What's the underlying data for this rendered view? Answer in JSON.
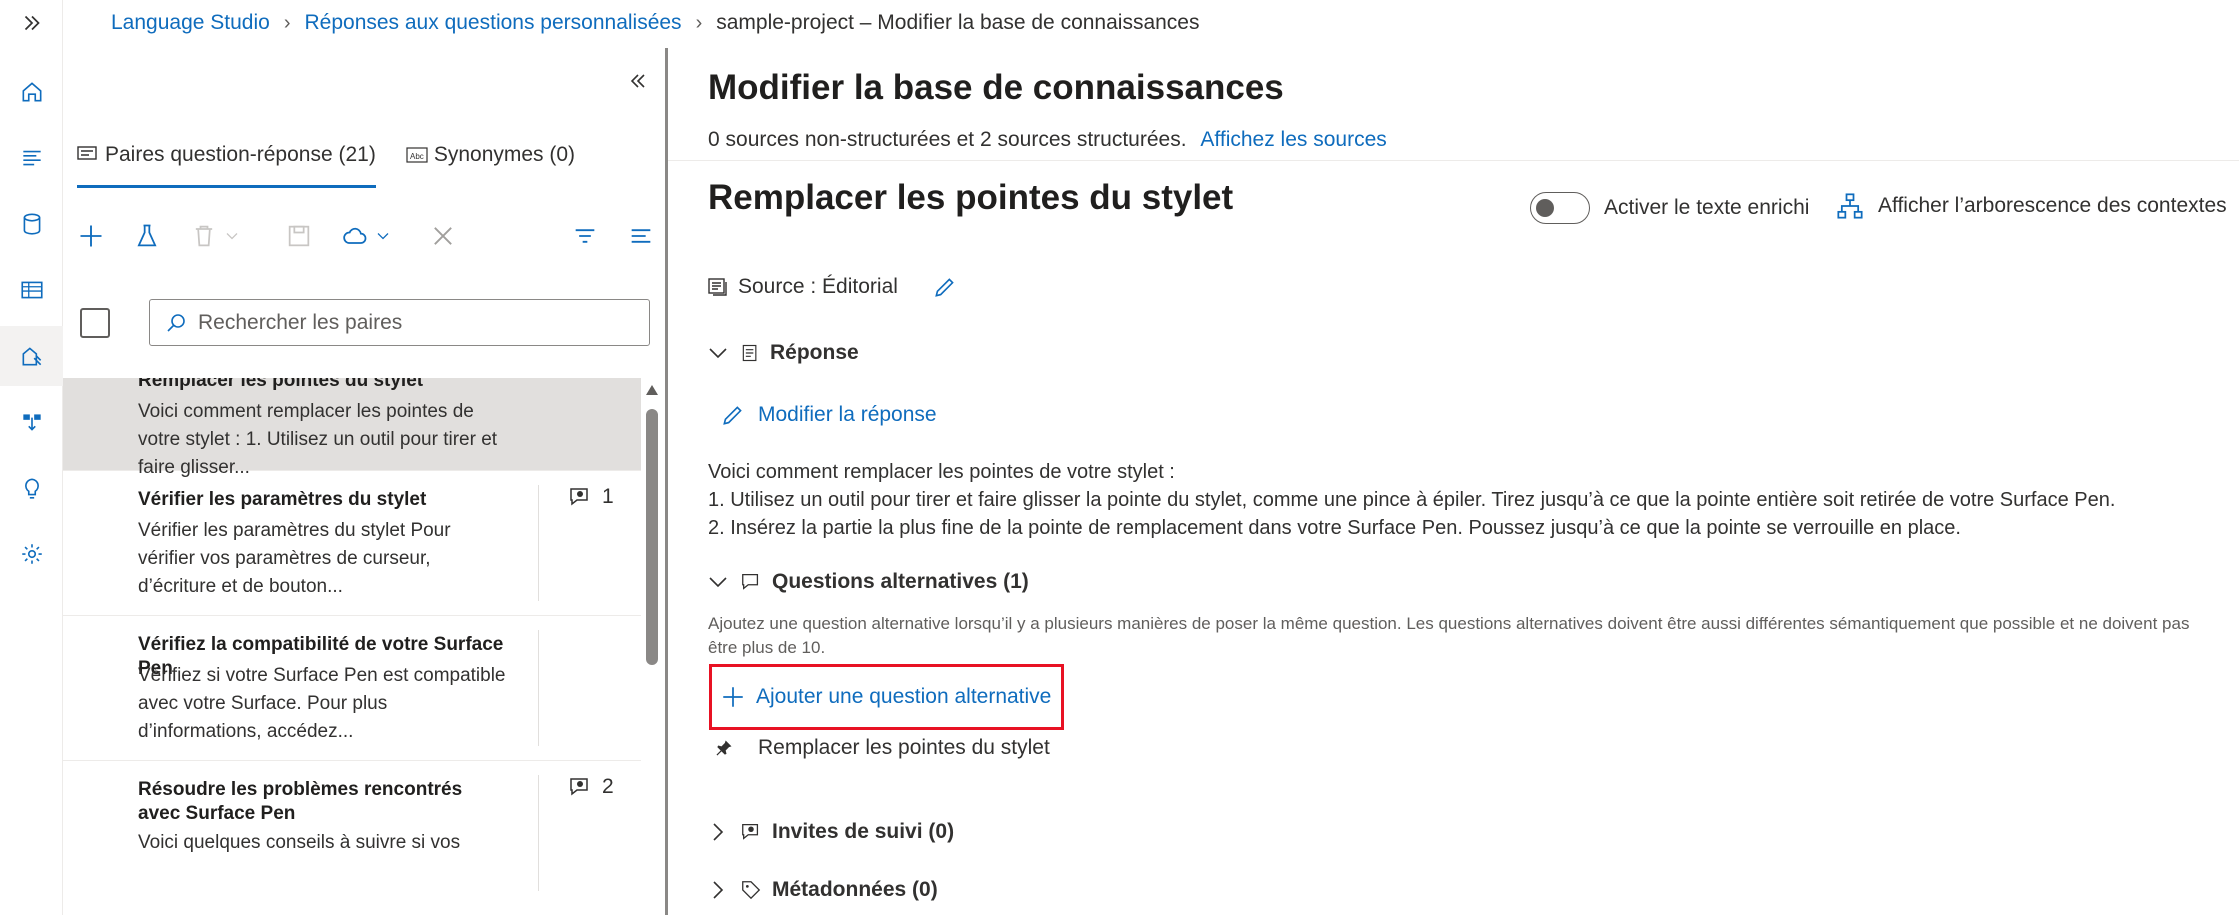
{
  "breadcrumb": {
    "items": [
      "Language Studio",
      "Réponses aux questions personnalisées",
      "sample-project – Modifier la base de connaissances"
    ]
  },
  "nav": {
    "icons": [
      "expand-icon",
      "home-icon",
      "text-icon",
      "database-icon",
      "table-icon",
      "knowledge-icon",
      "deploy-icon",
      "lightbulb-icon",
      "settings-icon"
    ]
  },
  "left": {
    "tabs": [
      {
        "label": "Paires question-réponse (21)",
        "icon": "qna-icon"
      },
      {
        "label": "Synonymes (0)",
        "icon": "abc-icon"
      }
    ],
    "search_placeholder": "Rechercher les paires",
    "items": [
      {
        "title": "Remplacer les pointes du stylet",
        "desc": "Voici comment remplacer les pointes de votre stylet : 1. Utilisez un outil pour tirer et faire glisser...",
        "badge": ""
      },
      {
        "title": "Vérifier les paramètres du stylet",
        "desc": "Vérifier les paramètres du stylet Pour vérifier vos paramètres de curseur, d’écriture et de bouton...",
        "badge": "1"
      },
      {
        "title": "Vérifiez la compatibilité de votre Surface Pen",
        "desc": "Vérifiez si votre Surface Pen est compatible avec votre Surface. Pour plus d’informations, accédez...",
        "badge": ""
      },
      {
        "title": "Résoudre les problèmes rencontrés avec Surface Pen",
        "desc": "Voici quelques conseils à suivre si vos",
        "badge": "2"
      }
    ]
  },
  "main": {
    "title": "Modifier la base de connaissances",
    "sources_text": "0 sources non-structurées et 2 sources structurées.",
    "sources_link": "Affichez les sources",
    "qna_title": "Remplacer les pointes du stylet",
    "rich_text_label": "Activer le texte enrichi",
    "tree_label": "Afficher l’arborescence des contextes",
    "source_label": "Source : Éditorial",
    "answer_section": "Réponse",
    "edit_answer": "Modifier la réponse",
    "answer_lines": [
      "Voici comment remplacer les pointes de votre stylet :",
      "1. Utilisez un outil pour tirer et faire glisser la pointe du stylet, comme une pince à épiler. Tirez jusqu’à ce que la pointe entière soit retirée de votre Surface Pen.",
      "2. Insérez la partie la plus fine de la pointe de remplacement dans votre Surface Pen. Poussez jusqu’à ce que la pointe se verrouille en place."
    ],
    "alt_section": "Questions alternatives (1)",
    "alt_help": "Ajoutez une question alternative lorsqu’il y a plusieurs manières de poser la même question. Les questions alternatives doivent être aussi différentes sémantiquement que possible et ne doivent pas être plus de 10.",
    "add_alt": "Ajouter une question alternative",
    "alt_question": "Remplacer les pointes du stylet",
    "followup_section": "Invites de suivi (0)",
    "metadata_section": "Métadonnées (0)"
  },
  "colors": {
    "accent": "#0f6cbd",
    "highlight_border": "#e81123",
    "selected_row": "#e1dfdd"
  }
}
